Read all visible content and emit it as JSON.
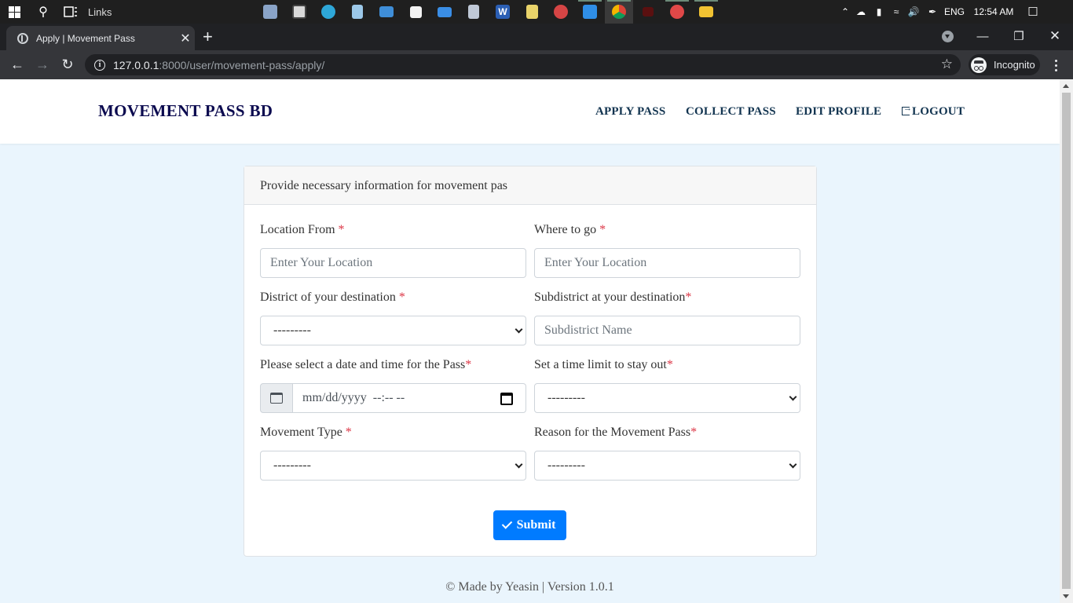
{
  "taskbar": {
    "links_label": "Links",
    "tray": {
      "language": "ENG",
      "time": "12:54 AM"
    },
    "apps": [
      {
        "icon": "photos-icon",
        "color": "#8aa4c8"
      },
      {
        "icon": "terminal-icon",
        "color": "#d9d9d9"
      },
      {
        "icon": "edge-icon",
        "color": "#2ea7d8"
      },
      {
        "icon": "notepad-icon",
        "color": "#9cc8e8"
      },
      {
        "icon": "monitor-icon",
        "color": "#3f8ed8"
      },
      {
        "icon": "store-icon",
        "color": "#f2f2f2"
      },
      {
        "icon": "mail-icon",
        "color": "#3a8ee6"
      },
      {
        "icon": "calculator-icon",
        "color": "#bfc8d6"
      },
      {
        "icon": "word-icon",
        "color": "#2b5fb4"
      },
      {
        "icon": "sticky-notes-icon",
        "color": "#e9d36a"
      },
      {
        "icon": "paint-icon",
        "color": "#d64545"
      },
      {
        "icon": "vscode-icon",
        "color": "#2f8ee6"
      },
      {
        "icon": "chrome-icon",
        "color": "#e2b32e"
      },
      {
        "icon": "app-red-icon",
        "color": "#c0392b"
      },
      {
        "icon": "chrome-red-icon",
        "color": "#e04848"
      },
      {
        "icon": "file-explorer-icon",
        "color": "#f1c232"
      }
    ]
  },
  "browser": {
    "tab_title": "Apply | Movement Pass",
    "new_tab": "+",
    "url_host": "127.0.0.1",
    "url_path": ":8000/user/movement-pass/apply/",
    "incognito_label": "Incognito"
  },
  "site": {
    "brand": "MOVEMENT PASS BD",
    "nav": {
      "apply": "APPLY PASS",
      "collect": "COLLECT PASS",
      "edit_profile": "EDIT PROFILE",
      "logout": "LOGOUT"
    }
  },
  "form": {
    "header": "Provide necessary information for movement pas",
    "required_marker": "*",
    "location_from": {
      "label": "Location From ",
      "placeholder": "Enter Your Location"
    },
    "where_to_go": {
      "label": "Where to go ",
      "placeholder": "Enter Your Location"
    },
    "district": {
      "label": "District of your destination ",
      "value": "---------"
    },
    "subdistrict": {
      "label": "Subdistrict at your destination",
      "placeholder": "Subdistrict Name"
    },
    "date_time": {
      "label": "Please select a date and time for the Pass",
      "value": "mm/dd/yyyy  --:-- --"
    },
    "time_limit": {
      "label": "Set a time limit to stay out",
      "value": "---------"
    },
    "movement_type": {
      "label": "Movement Type ",
      "value": "---------"
    },
    "reason": {
      "label": "Reason for the Movement Pass",
      "value": "---------"
    },
    "submit": "Submit"
  },
  "footer": "© Made by Yeasin | Version 1.0.1",
  "colors": {
    "brand": "#0b0a4f",
    "primary": "#007bff",
    "required": "#dc3545",
    "page_bg": "#eaf5fd"
  }
}
